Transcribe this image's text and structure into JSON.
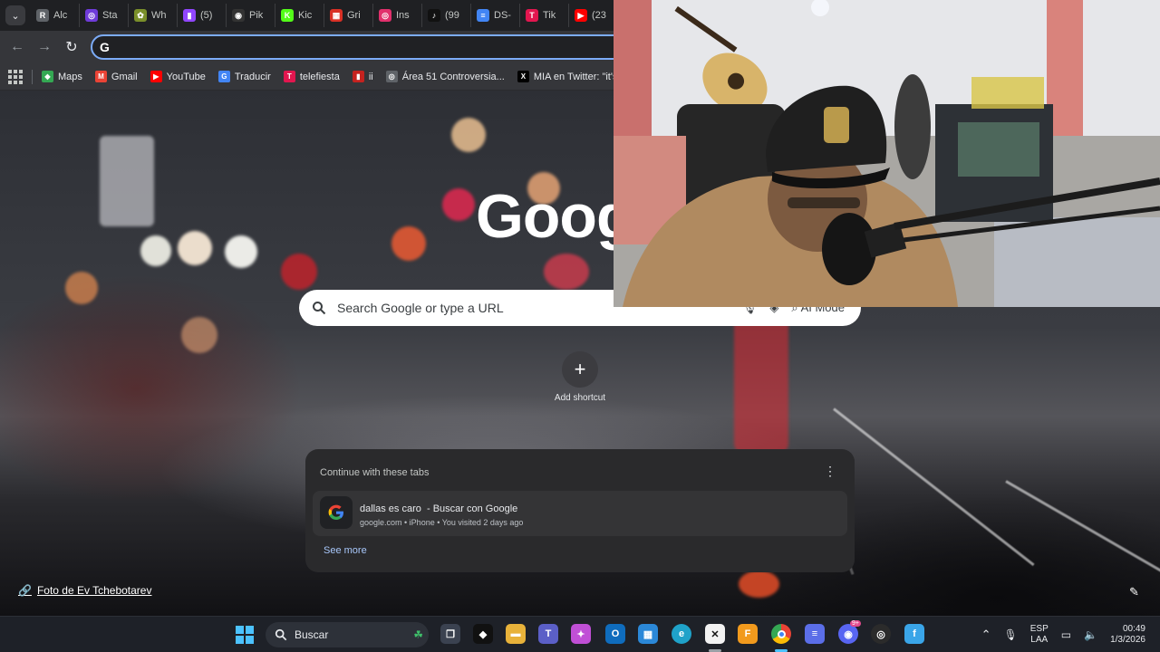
{
  "tabs": [
    {
      "label": "Alc",
      "icon": "roblox-icon",
      "color": "#5f6368",
      "glyph": "R"
    },
    {
      "label": "Sta",
      "icon": "stake-icon",
      "color": "#6f3bd9",
      "glyph": "◎"
    },
    {
      "label": "Wh",
      "icon": "plant-icon",
      "color": "#7a8f2a",
      "glyph": "✿"
    },
    {
      "label": "(5)",
      "icon": "twitch-icon",
      "color": "#9146ff",
      "glyph": "▮"
    },
    {
      "label": "Pik",
      "icon": "pikachu-icon",
      "color": "#333333",
      "glyph": "◉"
    },
    {
      "label": "Kic",
      "icon": "kick-icon",
      "color": "#53fc18",
      "glyph": "K"
    },
    {
      "label": "Gri",
      "icon": "grid-icon",
      "color": "#d93025",
      "glyph": "▦"
    },
    {
      "label": "Ins",
      "icon": "instagram-icon",
      "color": "#e1306c",
      "glyph": "◎"
    },
    {
      "label": "(99",
      "icon": "tiktok-icon",
      "color": "#111111",
      "glyph": "♪"
    },
    {
      "label": "DS-",
      "icon": "docs-icon",
      "color": "#4285f4",
      "glyph": "≡"
    },
    {
      "label": "Tik",
      "icon": "telefiesta-icon",
      "color": "#e2164f",
      "glyph": "T"
    },
    {
      "label": "(23",
      "icon": "youtube-icon",
      "color": "#ff0000",
      "glyph": "▶"
    }
  ],
  "bookmarks": [
    {
      "label": "Maps",
      "icon": "maps-icon",
      "color": "#34a853",
      "glyph": "◆"
    },
    {
      "label": "Gmail",
      "icon": "gmail-icon",
      "color": "#ea4335",
      "glyph": "M"
    },
    {
      "label": "YouTube",
      "icon": "youtube-icon",
      "color": "#ff0000",
      "glyph": "▶"
    },
    {
      "label": "Traducir",
      "icon": "translate-icon",
      "color": "#4285f4",
      "glyph": "G"
    },
    {
      "label": "telefiesta",
      "icon": "telefiesta-icon",
      "color": "#e2164f",
      "glyph": "T"
    },
    {
      "label": "ii",
      "icon": "bookmark-red-icon",
      "color": "#c5221f",
      "glyph": "▮"
    },
    {
      "label": "Área 51 Controversia...",
      "icon": "globe-icon",
      "color": "#5f6368",
      "glyph": "◎"
    },
    {
      "label": "MIA en Twitter: \"it's...",
      "icon": "x-icon",
      "color": "#000000",
      "glyph": "X"
    }
  ],
  "logo_text": "Goog",
  "search": {
    "placeholder": "Search Google or type a URL",
    "ai_mode": "AI Mode"
  },
  "add_shortcut_label": "Add shortcut",
  "continue": {
    "header": "Continue with these tabs",
    "item_title": "dallas es caro  - Buscar con Google",
    "item_meta": "google.com • iPhone • You visited 2 days ago",
    "see_more": "See more"
  },
  "photo_credit": "Foto de Ev Tchebotarev",
  "taskbar": {
    "search_label": "Buscar",
    "lang_top": "ESP",
    "lang_bottom": "LAA",
    "time": "00:49",
    "date": "1/3/2026",
    "discord_badge": "9+"
  }
}
